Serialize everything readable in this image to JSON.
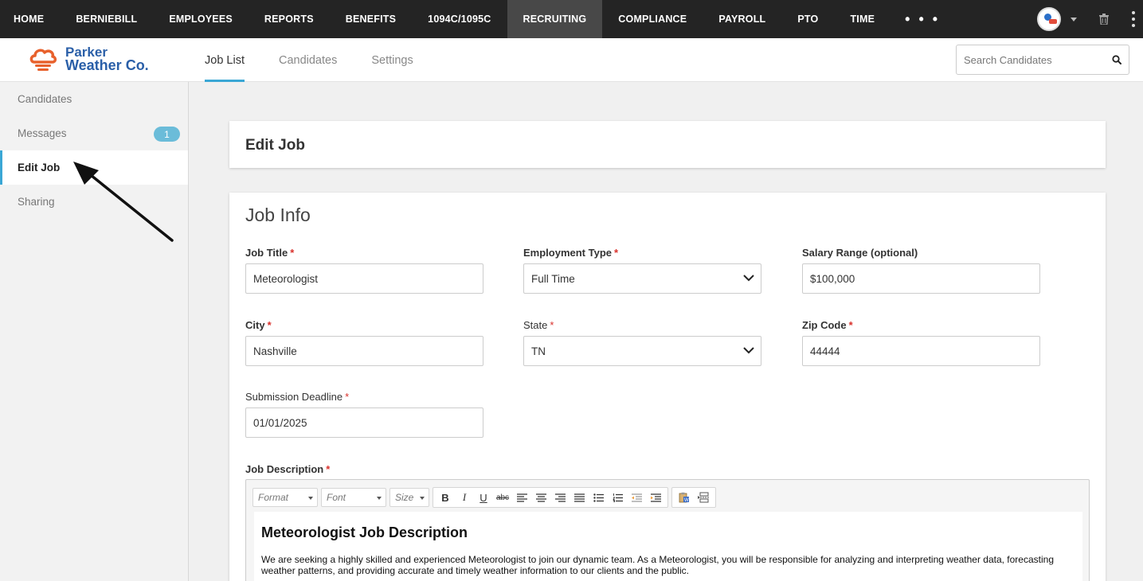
{
  "nav": {
    "items": [
      "HOME",
      "BERNIEBILL",
      "EMPLOYEES",
      "REPORTS",
      "BENEFITS",
      "1094C/1095C",
      "RECRUITING",
      "COMPLIANCE",
      "PAYROLL",
      "PTO",
      "TIME"
    ],
    "active": "RECRUITING",
    "more": "• • •"
  },
  "brand": {
    "line1": "Parker",
    "line2": "Weather Co."
  },
  "tabs": [
    "Job List",
    "Candidates",
    "Settings"
  ],
  "search": {
    "placeholder": "Search Candidates"
  },
  "sidebar": {
    "items": [
      {
        "label": "Candidates"
      },
      {
        "label": "Messages",
        "badge": "1"
      },
      {
        "label": "Edit Job"
      },
      {
        "label": "Sharing"
      }
    ]
  },
  "page": {
    "title": "Edit Job",
    "section": "Job Info"
  },
  "form": {
    "job_title": {
      "label": "Job Title",
      "value": "Meteorologist"
    },
    "employment_type": {
      "label": "Employment Type",
      "value": "Full Time"
    },
    "salary_range": {
      "label": "Salary Range (optional)",
      "value": "$100,000"
    },
    "city": {
      "label": "City",
      "value": "Nashville"
    },
    "state": {
      "label": "State",
      "value": "TN"
    },
    "zip_code": {
      "label": "Zip Code",
      "value": "44444"
    },
    "submission_deadline": {
      "label": "Submission Deadline",
      "value": "01/01/2025"
    },
    "job_description": {
      "label": "Job Description"
    },
    "required_marker": "*"
  },
  "editor": {
    "format_placeholder": "Format",
    "font_placeholder": "Font",
    "size_placeholder": "Size",
    "heading": "Meteorologist Job Description",
    "body": "We are seeking a highly skilled and experienced Meteorologist to join our dynamic team. As a Meteorologist, you will be responsible for analyzing and interpreting weather data, forecasting weather patterns, and providing accurate and timely weather information to our clients and the public."
  },
  "colors": {
    "nav_bg": "#242424",
    "accent": "#3aa7d5",
    "required": "#d9312c",
    "brand_blue": "#2a5fa8",
    "brand_orange": "#e8612c"
  }
}
